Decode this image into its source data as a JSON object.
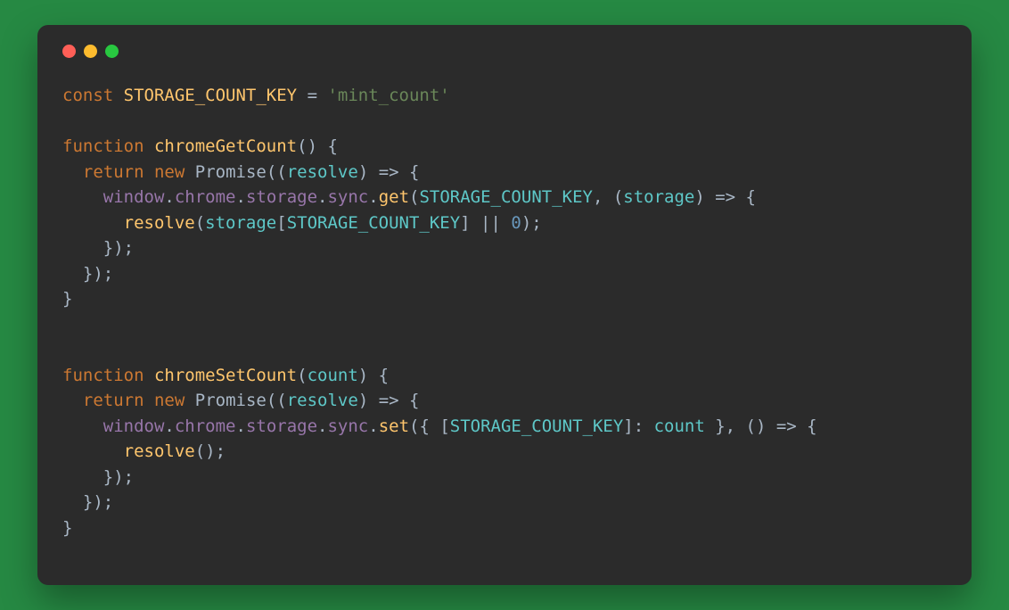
{
  "window": {
    "buttons": [
      "close",
      "minimize",
      "zoom"
    ]
  },
  "code": {
    "const_key_name": "STORAGE_COUNT_KEY",
    "const_key_value": "'mint_count'",
    "fn1_name": "chromeGetCount",
    "fn2_name": "chromeSetCount",
    "fn2_param": "count",
    "promise_ctor": "Promise",
    "resolve_param": "resolve",
    "storage_param": "storage",
    "count_param": "count",
    "chain_window": "window",
    "chain_chrome": "chrome",
    "chain_storage": "storage",
    "chain_sync": "sync",
    "chain_get": "get",
    "chain_set": "set",
    "resolve_call": "resolve",
    "zero": "0",
    "kw_const": "const",
    "kw_function": "function",
    "kw_return": "return",
    "kw_new": "new"
  }
}
